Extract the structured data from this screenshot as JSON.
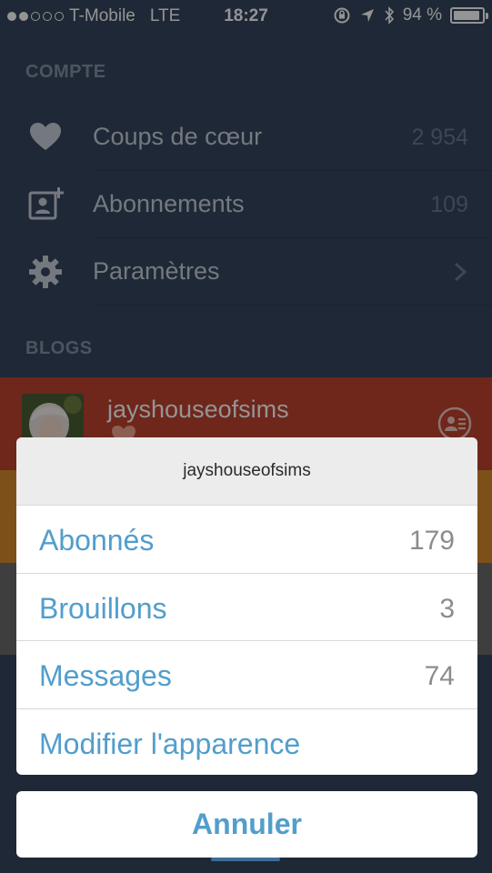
{
  "status_bar": {
    "signal_dots_filled": 2,
    "signal_dots_total": 5,
    "carrier": "T-Mobile",
    "network": "LTE",
    "time": "18:27",
    "battery": "94 %",
    "battery_level": 0.94
  },
  "account": {
    "section_title": "COMPTE",
    "items": [
      {
        "label": "Coups de cœur",
        "count": "2 954",
        "icon": "heart-icon"
      },
      {
        "label": "Abonnements",
        "count": "109",
        "icon": "add-contact-icon"
      },
      {
        "label": "Paramètres",
        "count": "",
        "icon": "gear-icon"
      }
    ]
  },
  "blogs": {
    "section_title": "BLOGS",
    "items": [
      {
        "name": "jayshouseofsims",
        "color": "#c0432f"
      }
    ]
  },
  "action_sheet": {
    "title": "jayshouseofsims",
    "options": [
      {
        "label": "Abonnés",
        "value": "179"
      },
      {
        "label": "Brouillons",
        "value": "3"
      },
      {
        "label": "Messages",
        "value": "74"
      },
      {
        "label": "Modifier l'apparence",
        "value": ""
      }
    ],
    "cancel_label": "Annuler"
  },
  "colors": {
    "accent": "#529ecc",
    "background": "#36465d"
  }
}
